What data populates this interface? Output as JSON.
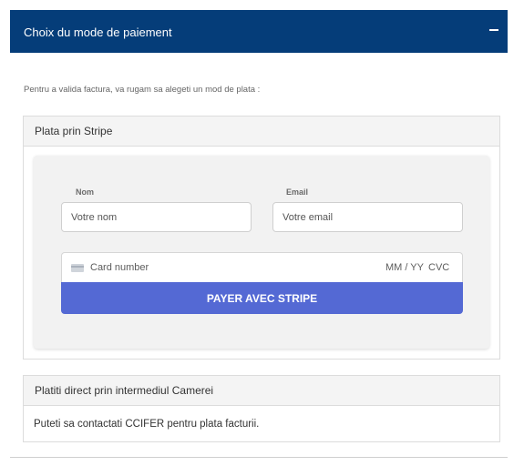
{
  "header": {
    "title": "Choix du mode de paiement"
  },
  "intro": "Pentru a valida factura, va rugam sa alegeti un mod de plata :",
  "stripe": {
    "title": "Plata prin Stripe",
    "name_label": "Nom",
    "name_placeholder": "Votre nom",
    "email_label": "Email",
    "email_placeholder": "Votre email",
    "card_placeholder": "Card number",
    "card_expiry_placeholder": "MM / YY",
    "card_cvc_placeholder": "CVC",
    "pay_button": "PAYER AVEC STRIPE"
  },
  "direct": {
    "title": "Platiti direct prin intermediul Camerei",
    "text": "Puteti sa contactati CCIFER pentru plata facturii."
  },
  "colors": {
    "header_bg": "#053d79",
    "pay_button_bg": "#5469d4"
  },
  "icons": {
    "collapse": "minus-icon",
    "card": "credit-card-icon"
  }
}
